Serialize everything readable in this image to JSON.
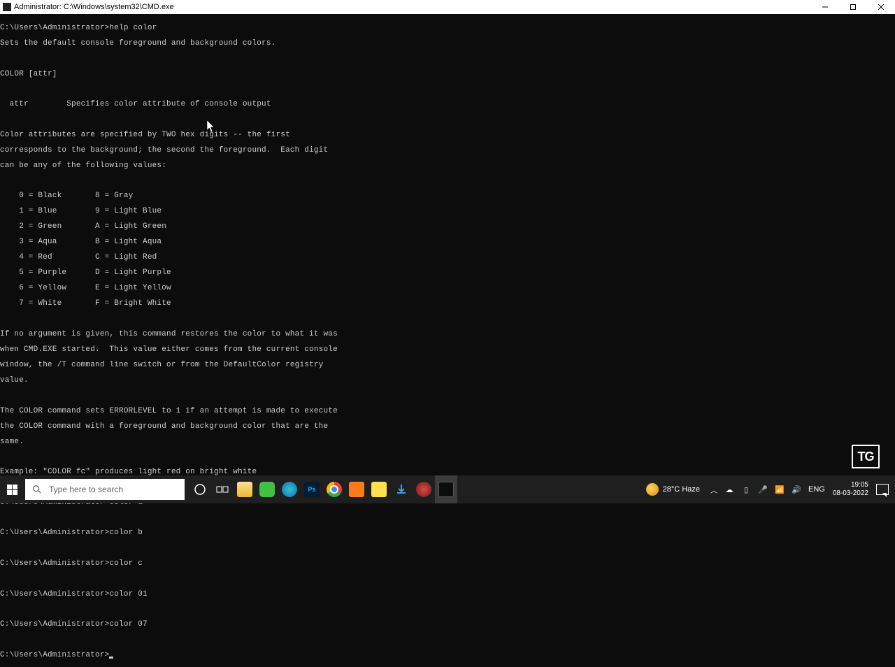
{
  "window": {
    "title": "Administrator: C:\\Windows\\system32\\CMD.exe"
  },
  "terminal": {
    "prompt": "C:\\Users\\Administrator>",
    "cmd_help": "help color",
    "out": [
      "Sets the default console foreground and background colors.",
      "",
      "COLOR [attr]",
      "",
      "  attr        Specifies color attribute of console output",
      "",
      "Color attributes are specified by TWO hex digits -- the first",
      "corresponds to the background; the second the foreground.  Each digit",
      "can be any of the following values:",
      "",
      "    0 = Black       8 = Gray",
      "    1 = Blue        9 = Light Blue",
      "    2 = Green       A = Light Green",
      "    3 = Aqua        B = Light Aqua",
      "    4 = Red         C = Light Red",
      "    5 = Purple      D = Light Purple",
      "    6 = Yellow      E = Light Yellow",
      "    7 = White       F = Bright White",
      "",
      "If no argument is given, this command restores the color to what it was",
      "when CMD.EXE started.  This value either comes from the current console",
      "window, the /T command line switch or from the DefaultColor registry",
      "value.",
      "",
      "The COLOR command sets ERRORLEVEL to 1 if an attempt is made to execute",
      "the COLOR command with a foreground and background color that are the",
      "same.",
      "",
      "Example: \"COLOR fc\" produces light red on bright white"
    ],
    "cmds": [
      "color a",
      "color b",
      "color c",
      "color 01",
      "color 07"
    ]
  },
  "badge": "TG",
  "taskbar": {
    "search_placeholder": "Type here to search",
    "weather_temp": "28°C",
    "weather_label": "Haze",
    "lang": "ENG",
    "time": "19:05",
    "date": "08-03-2022"
  }
}
